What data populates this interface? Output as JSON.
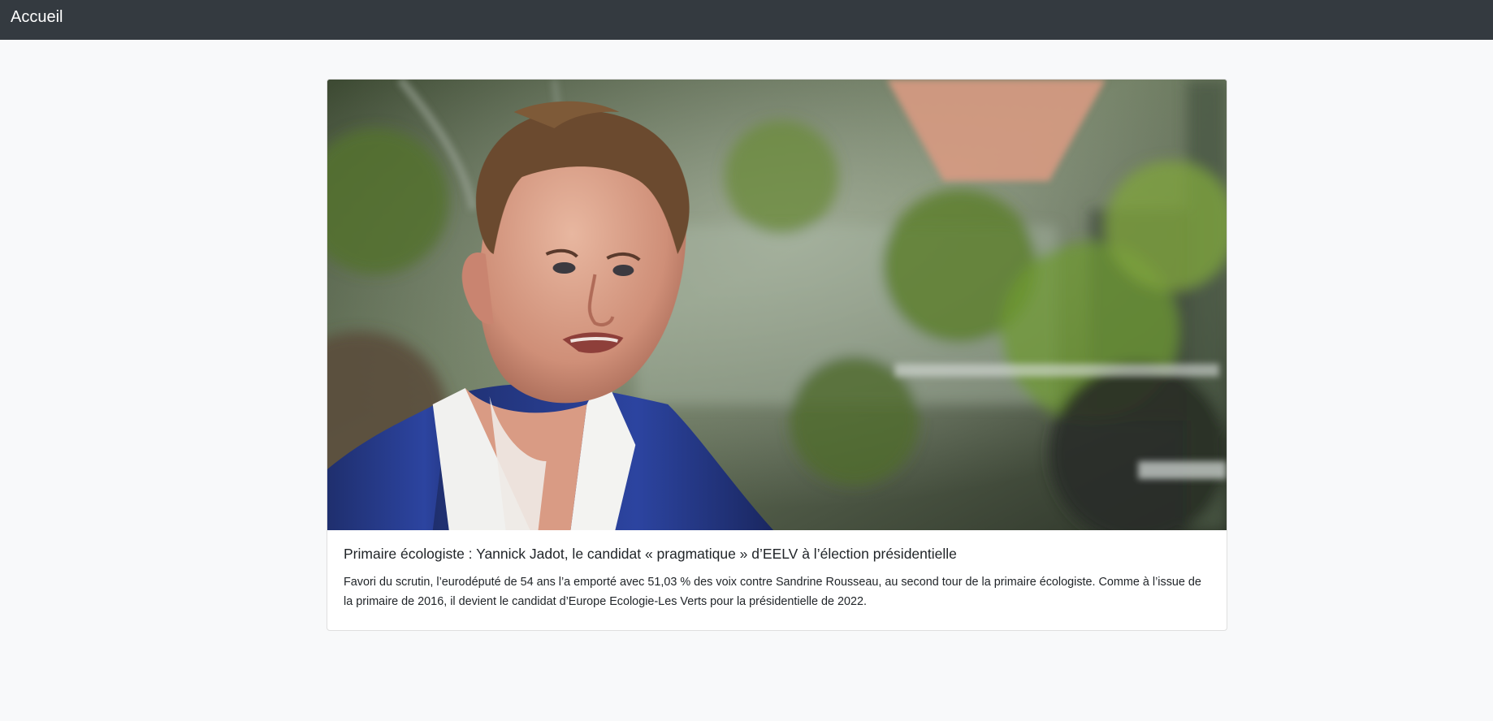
{
  "navbar": {
    "brand": "Accueil"
  },
  "article": {
    "image_alt": "Portrait of a man in a blue suit jacket and white shirt speaking, with green plants and a greenhouse in the background",
    "title": "Primaire écologiste : Yannick Jadot, le candidat « pragmatique » d’EELV à l’élection présidentielle",
    "summary": "Favori du scrutin, l’eurodéputé de 54 ans l’a emporté avec 51,03 % des voix contre Sandrine Rousseau, au second tour de la primaire écologiste. Comme à l’issue de la primaire de 2016, il devient le candidat d’Europe Ecologie-Les Verts pour la présidentielle de 2022."
  },
  "colors": {
    "navbar_bg": "#343a40",
    "page_bg": "#f8f9fa",
    "card_bg": "#ffffff",
    "text": "#212529"
  }
}
